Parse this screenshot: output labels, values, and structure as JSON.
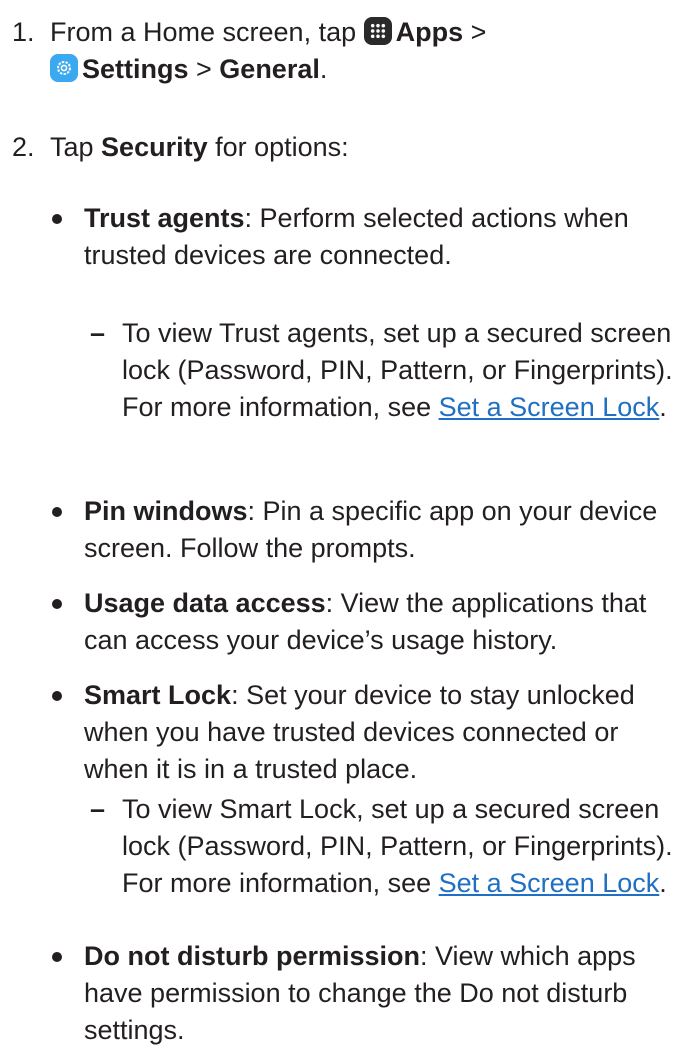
{
  "steps": [
    {
      "number": "1.",
      "prefix": "From a Home screen, tap ",
      "apps_label": "Apps",
      "sep1": " > ",
      "settings_label": "Settings",
      "sep2": " > ",
      "general_label": "General",
      "suffix": "."
    },
    {
      "number": "2.",
      "prefix": "Tap ",
      "security_label": "Security",
      "suffix": " for options:"
    }
  ],
  "bullets": [
    {
      "term": "Trust agents",
      "desc": ": Perform selected actions when trusted devices are connected."
    },
    {
      "term": "Pin windows",
      "desc": ": Pin a specific app on your device screen. Follow the prompts."
    },
    {
      "term": "Usage data access",
      "desc": ": View the applications that can access your device’s usage history."
    },
    {
      "term": "Smart Lock",
      "desc": ": Set your device to stay unlocked when you have trusted devices connected or when it is in a trusted place."
    },
    {
      "term": "Do not disturb permission",
      "desc": ": View which apps have permission to change the Do not disturb settings."
    }
  ],
  "subs": [
    {
      "dash": "–",
      "text": "To view Trust agents, set up a secured screen lock (Password, PIN, Pattern, or Fingerprints). For more information, see ",
      "link": "Set a Screen Lock",
      "end": "."
    },
    {
      "dash": "–",
      "text": "To view Smart Lock, set up a secured screen lock (Password, PIN, Pattern, or Fingerprints). For more information, see ",
      "link": "Set a Screen Lock",
      "end": "."
    }
  ],
  "icons": {
    "apps": "apps-grid-icon",
    "settings": "settings-gear-icon"
  },
  "colors": {
    "text": "#231f20",
    "link": "#1f6fc4",
    "settings_icon_bg": "#3aa9f0",
    "apps_icon_bg": "#2a2a2a"
  }
}
